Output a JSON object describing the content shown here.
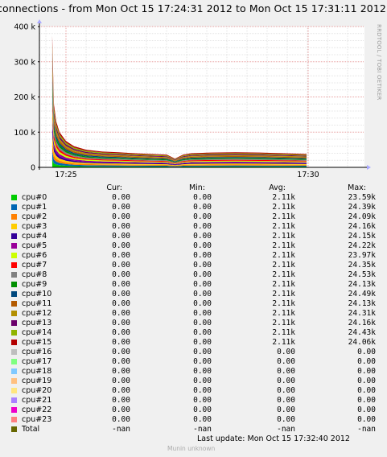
{
  "title": "connections - from Mon Oct 15 17:24:31 2012 to Mon Oct 15 17:31:11 2012",
  "rrdtool_label": "RRDTOOL / TOBI OETIKER",
  "columns": {
    "cur": "Cur:",
    "min": "Min:",
    "avg": "Avg:",
    "max": "Max:"
  },
  "last_update": "Last update:  Mon Oct 15 17:32:40 2012",
  "footer": "Munin unknown",
  "chart_data": {
    "type": "area",
    "stacked": true,
    "title": "connections - from Mon Oct 15 17:24:31 2012 to Mon Oct 15 17:31:11 2012",
    "y_ticks": [
      "0",
      "100 k",
      "200 k",
      "300 k",
      "400 k"
    ],
    "x_ticks": [
      "17:25",
      "17:30"
    ],
    "ylim": [
      0,
      400000
    ],
    "grid": true,
    "legend_placement": "bottom",
    "total_envelope": {
      "time": [
        "17:24:43",
        "17:24:45",
        "17:24:48",
        "17:24:52",
        "17:25:00",
        "17:25:10",
        "17:25:25",
        "17:25:45",
        "17:26:05",
        "17:26:25",
        "17:26:45",
        "17:27:05",
        "17:27:15",
        "17:27:25",
        "17:27:35",
        "17:28:00",
        "17:28:30",
        "17:29:00",
        "17:29:30",
        "17:29:58"
      ],
      "value": [
        375000,
        180000,
        130000,
        100000,
        75000,
        60000,
        50000,
        45000,
        43000,
        40000,
        38000,
        36000,
        25000,
        36000,
        40000,
        42000,
        43000,
        42000,
        40000,
        38000
      ]
    },
    "series": [
      {
        "name": "cpu#0",
        "color": "#00cc00",
        "cur": "0.00",
        "min": "0.00",
        "avg": "2.11k",
        "max": "23.59k"
      },
      {
        "name": "cpu#1",
        "color": "#0066b3",
        "cur": "0.00",
        "min": "0.00",
        "avg": "2.11k",
        "max": "24.39k"
      },
      {
        "name": "cpu#2",
        "color": "#ff8000",
        "cur": "0.00",
        "min": "0.00",
        "avg": "2.11k",
        "max": "24.09k"
      },
      {
        "name": "cpu#3",
        "color": "#ffcc00",
        "cur": "0.00",
        "min": "0.00",
        "avg": "2.11k",
        "max": "24.16k"
      },
      {
        "name": "cpu#4",
        "color": "#330099",
        "cur": "0.00",
        "min": "0.00",
        "avg": "2.11k",
        "max": "24.15k"
      },
      {
        "name": "cpu#5",
        "color": "#990099",
        "cur": "0.00",
        "min": "0.00",
        "avg": "2.11k",
        "max": "24.22k"
      },
      {
        "name": "cpu#6",
        "color": "#ccff00",
        "cur": "0.00",
        "min": "0.00",
        "avg": "2.11k",
        "max": "23.97k"
      },
      {
        "name": "cpu#7",
        "color": "#ff0000",
        "cur": "0.00",
        "min": "0.00",
        "avg": "2.11k",
        "max": "24.35k"
      },
      {
        "name": "cpu#8",
        "color": "#808080",
        "cur": "0.00",
        "min": "0.00",
        "avg": "2.11k",
        "max": "24.53k"
      },
      {
        "name": "cpu#9",
        "color": "#008f00",
        "cur": "0.00",
        "min": "0.00",
        "avg": "2.11k",
        "max": "24.13k"
      },
      {
        "name": "cpu#10",
        "color": "#00487d",
        "cur": "0.00",
        "min": "0.00",
        "avg": "2.11k",
        "max": "24.49k"
      },
      {
        "name": "cpu#11",
        "color": "#b35a00",
        "cur": "0.00",
        "min": "0.00",
        "avg": "2.11k",
        "max": "24.13k"
      },
      {
        "name": "cpu#12",
        "color": "#b38f00",
        "cur": "0.00",
        "min": "0.00",
        "avg": "2.11k",
        "max": "24.31k"
      },
      {
        "name": "cpu#13",
        "color": "#6b006b",
        "cur": "0.00",
        "min": "0.00",
        "avg": "2.11k",
        "max": "24.16k"
      },
      {
        "name": "cpu#14",
        "color": "#8fb300",
        "cur": "0.00",
        "min": "0.00",
        "avg": "2.11k",
        "max": "24.43k"
      },
      {
        "name": "cpu#15",
        "color": "#b30000",
        "cur": "0.00",
        "min": "0.00",
        "avg": "2.11k",
        "max": "24.06k"
      },
      {
        "name": "cpu#16",
        "color": "#bebebe",
        "cur": "0.00",
        "min": "0.00",
        "avg": "0.00",
        "max": "0.00"
      },
      {
        "name": "cpu#17",
        "color": "#80ff80",
        "cur": "0.00",
        "min": "0.00",
        "avg": "0.00",
        "max": "0.00"
      },
      {
        "name": "cpu#18",
        "color": "#80c9ff",
        "cur": "0.00",
        "min": "0.00",
        "avg": "0.00",
        "max": "0.00"
      },
      {
        "name": "cpu#19",
        "color": "#ffc080",
        "cur": "0.00",
        "min": "0.00",
        "avg": "0.00",
        "max": "0.00"
      },
      {
        "name": "cpu#20",
        "color": "#ffe680",
        "cur": "0.00",
        "min": "0.00",
        "avg": "0.00",
        "max": "0.00"
      },
      {
        "name": "cpu#21",
        "color": "#aa80ff",
        "cur": "0.00",
        "min": "0.00",
        "avg": "0.00",
        "max": "0.00"
      },
      {
        "name": "cpu#22",
        "color": "#ee00cc",
        "cur": "0.00",
        "min": "0.00",
        "avg": "0.00",
        "max": "0.00"
      },
      {
        "name": "cpu#23",
        "color": "#ff8080",
        "cur": "0.00",
        "min": "0.00",
        "avg": "0.00",
        "max": "0.00"
      },
      {
        "name": "Total",
        "color": "#666600",
        "cur": "-nan",
        "min": "-nan",
        "avg": "-nan",
        "max": "-nan"
      }
    ]
  }
}
